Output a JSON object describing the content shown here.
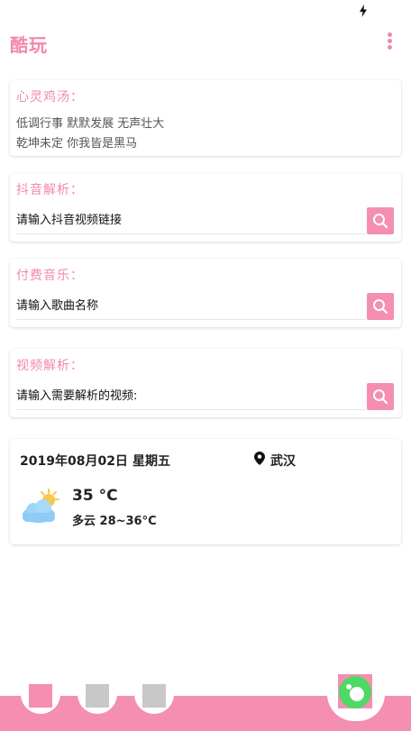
{
  "app": {
    "title": "酷玩"
  },
  "quote": {
    "title": "心灵鸡汤：",
    "line1": "低调行事 默默发展 无声壮大",
    "line2": "乾坤未定 你我皆是黑马"
  },
  "douyin": {
    "title": "抖音解析：",
    "placeholder": "请输入抖音视频链接"
  },
  "music": {
    "title": "付费音乐：",
    "placeholder": "请输入歌曲名称"
  },
  "video": {
    "title": "视频解析：",
    "placeholder": "请输入需要解析的视频:"
  },
  "weather": {
    "date": "2019年08月02日",
    "weekday": "星期五",
    "city": "武汉",
    "temp": "35 °C",
    "range": "多云 28~36°C",
    "icon": "partly-cloudy-icon"
  },
  "nav": {
    "tabs": [
      {
        "name": "tab-1",
        "color": "#f48fb1",
        "active": true
      },
      {
        "name": "tab-2",
        "color": "#c8c8c8",
        "active": false
      },
      {
        "name": "tab-3",
        "color": "#c8c8c8",
        "active": false
      }
    ],
    "center_icon": "green-circle-icon"
  },
  "colors": {
    "accent": "#f288ad",
    "button": "#f48fb1",
    "inactive": "#c8c8c8",
    "green": "#4cd964"
  }
}
